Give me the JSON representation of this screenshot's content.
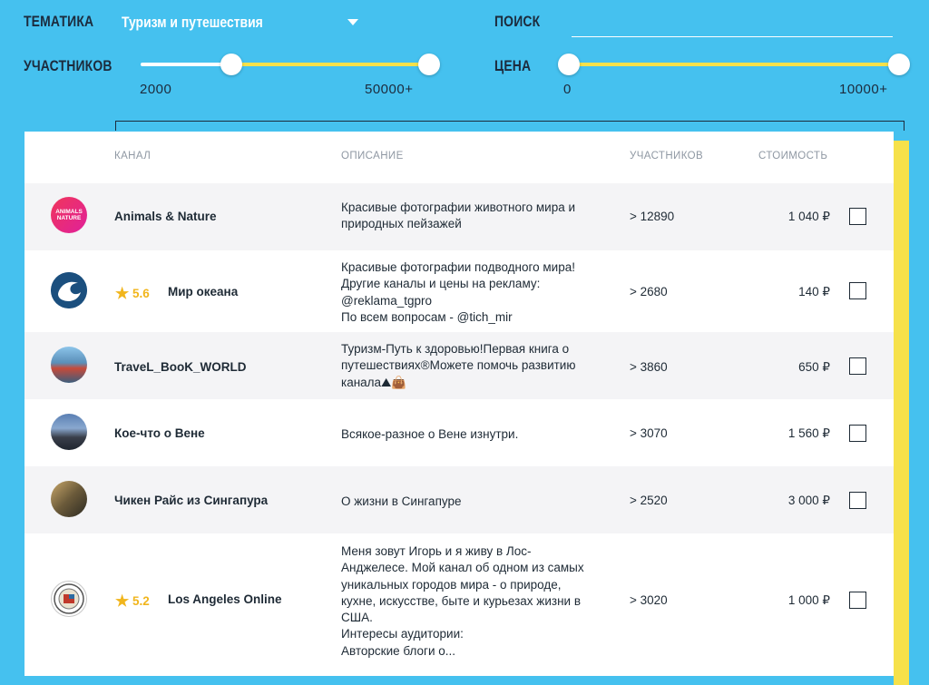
{
  "filters": {
    "topic_label": "ТЕМАТИКА",
    "topic_value": "Туризм и путешествия",
    "search_label": "ПОИСК",
    "search_value": "",
    "members_label": "УЧАСТНИКОВ",
    "members_min": "2000",
    "members_max": "50000+",
    "price_label": "ЦЕНА",
    "price_min": "0",
    "price_max": "10000+"
  },
  "table": {
    "headers": {
      "channel": "КАНАЛ",
      "description": "ОПИСАНИЕ",
      "members": "УЧАСТНИКОВ",
      "price": "СТОИМОСТЬ"
    },
    "rows": [
      {
        "name": "Animals & Nature",
        "rating": "",
        "avatar_text": "ANIMALS NATURE",
        "description": [
          "Красивые фотографии животного мира и",
          "природных пейзажей"
        ],
        "members": "> 12890",
        "price": "1 040 ₽"
      },
      {
        "name": "Мир океана",
        "rating": "5.6",
        "avatar_text": "",
        "description": [
          "Красивые фотографии подводного мира!",
          "Другие каналы и цены на рекламу:",
          "@reklama_tgpro",
          "По всем вопросам - @tich_mir"
        ],
        "members": "> 2680",
        "price": "140 ₽"
      },
      {
        "name": "TraveL_BooK_WORLD",
        "rating": "",
        "avatar_text": "",
        "description": [
          "Туризм-Путь к здоровью!Первая книга о",
          "путешествиях®Можете помочь развитию",
          "канала⛰👜"
        ],
        "members": "> 3860",
        "price": "650 ₽"
      },
      {
        "name": "Кое-что о Вене",
        "rating": "",
        "avatar_text": "",
        "description": [
          "Всякое-разное о Вене изнутри."
        ],
        "members": "> 3070",
        "price": "1 560 ₽"
      },
      {
        "name": "Чикен Райс из Сингапура",
        "rating": "",
        "avatar_text": "",
        "description": [
          "О жизни в Сингапуре"
        ],
        "members": "> 2520",
        "price": "3 000 ₽"
      },
      {
        "name": "Los Angeles Online",
        "rating": "5.2",
        "avatar_text": "",
        "description": [
          "Меня зовут Игорь и я живу в Лос-",
          "Анджелесе. Мой канал об одном из самых",
          "уникальных городов мира - о природе,",
          "кухне, искусстве, быте и курьезах жизни в",
          "США.",
          "Интересы аудитории:",
          "Авторские блоги о..."
        ],
        "members": "> 3020",
        "price": "1 000 ₽"
      }
    ]
  },
  "colors": {
    "background": "#45c1ef",
    "accent_yellow": "#f6e14a",
    "star": "#f1b51c"
  }
}
